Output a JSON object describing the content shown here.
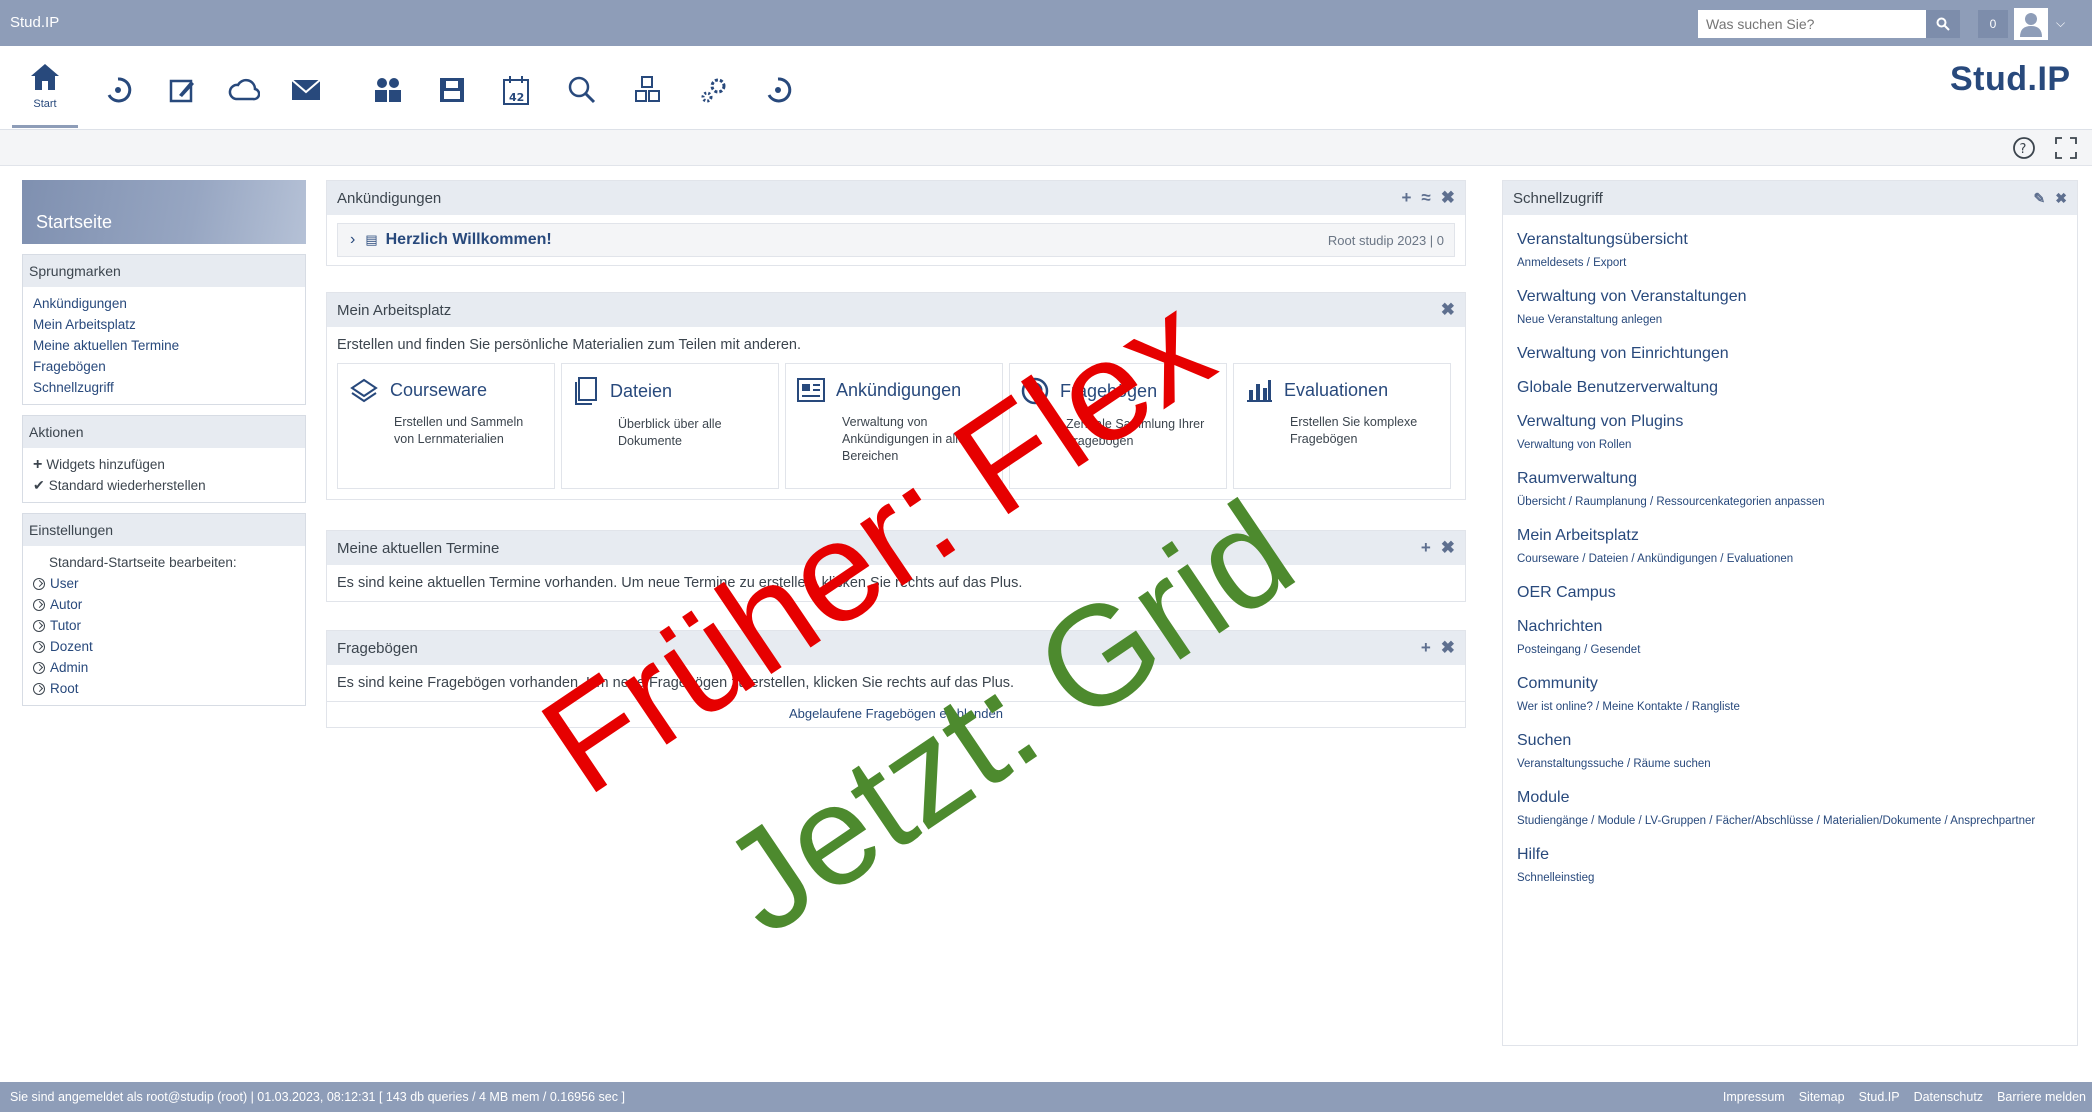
{
  "topbar": {
    "site": "Stud.IP",
    "search_placeholder": "Was suchen Sie?",
    "notifications": "0"
  },
  "nav": {
    "start_label": "Start",
    "logo": "Stud.IP"
  },
  "sidebar": {
    "title": "Startseite",
    "jump_title": "Sprungmarken",
    "jump_items": [
      "Ankündigungen",
      "Mein Arbeitsplatz",
      "Meine aktuellen Termine",
      "Fragebögen",
      "Schnellzugriff"
    ],
    "actions_title": "Aktionen",
    "actions": [
      "Widgets hinzufügen",
      "Standard wiederherstellen"
    ],
    "settings_title": "Einstellungen",
    "settings_label": "Standard-Startseite bearbeiten:",
    "roles": [
      "User",
      "Autor",
      "Tutor",
      "Dozent",
      "Admin",
      "Root"
    ]
  },
  "announcements": {
    "title": "Ankündigungen",
    "item": "Herzlich Willkommen!",
    "meta": "Root studip 2023 | 0"
  },
  "workspace": {
    "title": "Mein Arbeitsplatz",
    "intro": "Erstellen und finden Sie persönliche Materialien zum Teilen mit anderen.",
    "tiles": [
      {
        "name": "Courseware",
        "desc": "Erstellen und Sammeln von Lernmaterialien"
      },
      {
        "name": "Dateien",
        "desc": "Überblick über alle Dokumente"
      },
      {
        "name": "Ankündigungen",
        "desc": "Verwaltung von Ankündigungen in allen Bereichen"
      },
      {
        "name": "Fragebögen",
        "desc": "Zentrale Sammlung Ihrer Fragebögen"
      },
      {
        "name": "Evaluationen",
        "desc": "Erstellen Sie komplexe Fragebögen"
      }
    ]
  },
  "dates": {
    "title": "Meine aktuellen Termine",
    "text": "Es sind keine aktuellen Termine vorhanden. Um neue Termine zu erstellen, klicken Sie rechts auf das Plus."
  },
  "questionnaires": {
    "title": "Fragebögen",
    "text": "Es sind keine Fragebögen vorhanden. Um neue Fragebögen zu erstellen, klicken Sie rechts auf das Plus.",
    "link": "Abgelaufene Fragebögen einblenden"
  },
  "quick": {
    "title": "Schnellzugriff",
    "items": [
      {
        "title": "Veranstaltungsübersicht",
        "sub": "Anmeldesets / Export"
      },
      {
        "title": "Verwaltung von Veranstaltungen",
        "sub": "Neue Veranstaltung anlegen"
      },
      {
        "title": "Verwaltung von Einrichtungen",
        "sub": ""
      },
      {
        "title": "Globale Benutzerverwaltung",
        "sub": ""
      },
      {
        "title": "Verwaltung von Plugins",
        "sub": "Verwaltung von Rollen"
      },
      {
        "title": "Raumverwaltung",
        "sub": "Übersicht / Raumplanung / Ressourcenkategorien anpassen"
      },
      {
        "title": "Mein Arbeitsplatz",
        "sub": "Courseware / Dateien / Ankündigungen / Evaluationen"
      },
      {
        "title": "OER Campus",
        "sub": ""
      },
      {
        "title": "Nachrichten",
        "sub": "Posteingang / Gesendet"
      },
      {
        "title": "Community",
        "sub": "Wer ist online? / Meine Kontakte / Rangliste"
      },
      {
        "title": "Suchen",
        "sub": "Veranstaltungssuche / Räume suchen"
      },
      {
        "title": "Module",
        "sub": "Studiengänge / Module / LV-Gruppen / Fächer/Abschlüsse / Materialien/Dokumente / Ansprechpartner"
      },
      {
        "title": "Hilfe",
        "sub": "Schnelleinstieg"
      }
    ]
  },
  "footer": {
    "status": "Sie sind angemeldet als root@studip (root) | 01.03.2023, 08:12:31 [ 143 db queries / 4 MB mem / 0.16956 sec ]",
    "links": [
      "Impressum",
      "Sitemap",
      "Stud.IP",
      "Datenschutz",
      "Barriere melden"
    ]
  },
  "overlay": {
    "red": "Früher: Flex",
    "green": "Jetzt: Grid"
  },
  "colors": {
    "brand": "#28497c",
    "bar": "#8e9db8",
    "overlay_red": "#e60000",
    "overlay_green": "#4d8a2e"
  }
}
